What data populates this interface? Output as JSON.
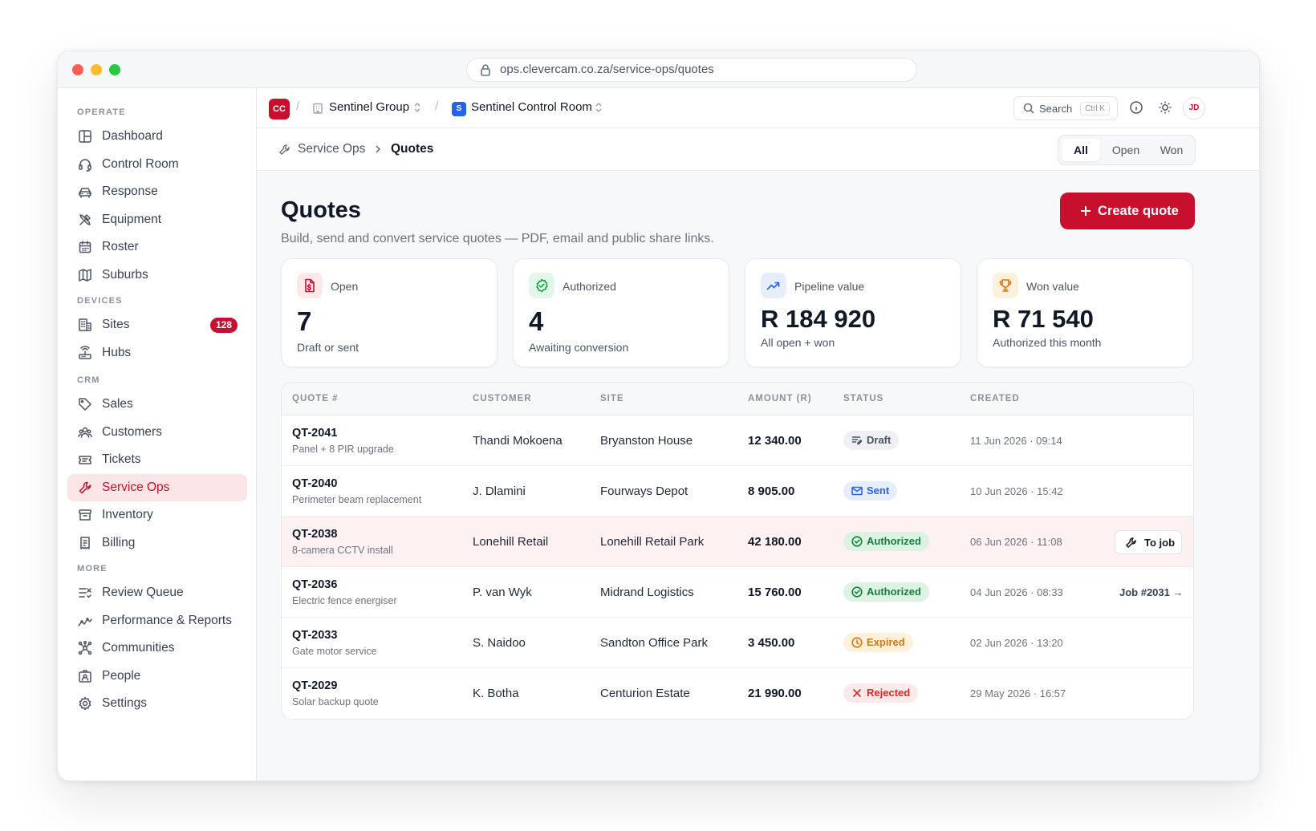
{
  "browser": {
    "url": "ops.clevercam.co.za/service-ops/quotes"
  },
  "sidebar": {
    "sections": [
      {
        "label": "OPERATE",
        "items": [
          {
            "label": "Dashboard",
            "icon": "layout-icon"
          },
          {
            "label": "Control Room",
            "icon": "headset-icon"
          },
          {
            "label": "Response",
            "icon": "car-icon"
          },
          {
            "label": "Equipment",
            "icon": "tools-icon"
          },
          {
            "label": "Roster",
            "icon": "calendar-icon"
          },
          {
            "label": "Suburbs",
            "icon": "map-icon"
          }
        ]
      },
      {
        "label": "DEVICES",
        "items": [
          {
            "label": "Sites",
            "icon": "building-icon",
            "badge": "128"
          },
          {
            "label": "Hubs",
            "icon": "router-icon"
          }
        ]
      },
      {
        "label": "CRM",
        "items": [
          {
            "label": "Sales",
            "icon": "tag-icon"
          },
          {
            "label": "Customers",
            "icon": "users-icon"
          },
          {
            "label": "Tickets",
            "icon": "ticket-icon"
          },
          {
            "label": "Service Ops",
            "icon": "wrench-icon",
            "active": true
          },
          {
            "label": "Inventory",
            "icon": "archive-icon"
          },
          {
            "label": "Billing",
            "icon": "receipt-icon"
          }
        ]
      },
      {
        "label": "MORE",
        "items": [
          {
            "label": "Review Queue",
            "icon": "list-check-icon"
          },
          {
            "label": "Performance & Reports",
            "icon": "trend-icon"
          },
          {
            "label": "Communities",
            "icon": "network-icon"
          },
          {
            "label": "People",
            "icon": "id-card-icon"
          },
          {
            "label": "Settings",
            "icon": "gear-icon"
          }
        ]
      }
    ]
  },
  "topbar": {
    "org_initials": "CC",
    "org_name": "Sentinel Group",
    "site_initial": "S",
    "site_name": "Sentinel Control Room",
    "search_label": "Search",
    "search_shortcut": "Ctrl K",
    "avatar_initials": "JD"
  },
  "crumbs": {
    "section": "Service Ops",
    "page": "Quotes"
  },
  "filter_tabs": [
    "All",
    "Open",
    "Won"
  ],
  "filter_active": "All",
  "page": {
    "title": "Quotes",
    "subtitle": "Build, send and convert service quotes — PDF, email and public share links.",
    "create_label": "Create quote"
  },
  "stats": [
    {
      "title": "Open",
      "value": "7",
      "desc": "Draft or sent",
      "icon": "file-dollar-icon",
      "color": "#c8102e",
      "bg": "#fde8ea"
    },
    {
      "title": "Authorized",
      "value": "4",
      "desc": "Awaiting conversion",
      "icon": "badge-check-icon",
      "color": "#16a34a",
      "bg": "#e4f6ea"
    },
    {
      "title": "Pipeline value",
      "value": "R 184 920",
      "desc": "All open + won",
      "icon": "trend-up-icon",
      "color": "#2563eb",
      "bg": "#e6eefc"
    },
    {
      "title": "Won value",
      "value": "R 71 540",
      "desc": "Authorized this month",
      "icon": "trophy-icon",
      "color": "#d97706",
      "bg": "#fdf1dc"
    }
  ],
  "table": {
    "headers": [
      "QUOTE #",
      "CUSTOMER",
      "SITE",
      "AMOUNT (R)",
      "STATUS",
      "CREATED"
    ],
    "rows": [
      {
        "id": "QT-2041",
        "desc": "Panel + 8 PIR upgrade",
        "customer": "Thandi Mokoena",
        "site": "Bryanston House",
        "amount": "12 340.00",
        "status": "Draft",
        "created": "11 Jun 2026 · 09:14",
        "action": ""
      },
      {
        "id": "QT-2040",
        "desc": "Perimeter beam replacement",
        "customer": "J. Dlamini",
        "site": "Fourways Depot",
        "amount": "8 905.00",
        "status": "Sent",
        "created": "10 Jun 2026 · 15:42",
        "action": ""
      },
      {
        "id": "QT-2038",
        "desc": "8-camera CCTV install",
        "customer": "Lonehill Retail",
        "site": "Lonehill Retail Park",
        "amount": "42 180.00",
        "status": "Authorized",
        "created": "06 Jun 2026 · 11:08",
        "action": "To job"
      },
      {
        "id": "QT-2036",
        "desc": "Electric fence energiser",
        "customer": "P. van Wyk",
        "site": "Midrand Logistics",
        "amount": "15 760.00",
        "status": "Authorized",
        "created": "04 Jun 2026 · 08:33",
        "action": "Job #2031 →"
      },
      {
        "id": "QT-2033",
        "desc": "Gate motor service",
        "customer": "S. Naidoo",
        "site": "Sandton Office Park",
        "amount": "3 450.00",
        "status": "Expired",
        "created": "02 Jun 2026 · 13:20",
        "action": ""
      },
      {
        "id": "QT-2029",
        "desc": "Solar backup quote",
        "customer": "K. Botha",
        "site": "Centurion Estate",
        "amount": "21 990.00",
        "status": "Rejected",
        "created": "29 May 2026 · 16:57",
        "action": ""
      }
    ]
  },
  "status_colors": {
    "Draft": {
      "fg": "#4b5563",
      "bg": "#eef0f3"
    },
    "Sent": {
      "fg": "#2563eb",
      "bg": "#e6eefc"
    },
    "Authorized": {
      "fg": "#15803d",
      "bg": "#dcf2e3"
    },
    "Expired": {
      "fg": "#d97706",
      "bg": "#fdf1dc"
    },
    "Rejected": {
      "fg": "#dc2626",
      "bg": "#fde8ea"
    }
  },
  "colors": {
    "brand": "#c8102e",
    "accent_blue": "#2563eb"
  }
}
